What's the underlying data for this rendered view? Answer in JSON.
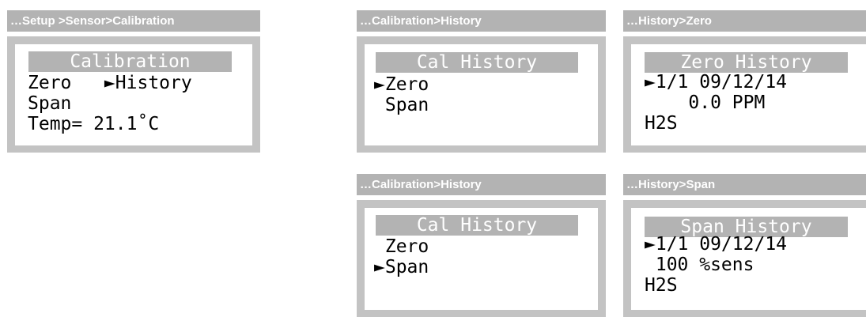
{
  "p1": {
    "header": "…Setup >Sensor>Calibration",
    "title": "Calibration",
    "line1": "Zero   ►History",
    "line2": "Span",
    "line3": "Temp= 21.1˚C"
  },
  "p2": {
    "header": "…Calibration>History",
    "title": "Cal History",
    "line1": "►Zero",
    "line2": " Span"
  },
  "p3": {
    "header": "…History>Zero",
    "title": "Zero History",
    "line1": "►1/1 09/12/14",
    "line2": "    0.0 PPM",
    "line3": "H2S"
  },
  "p4": {
    "header": "…Calibration>History",
    "title": "Cal History",
    "line1": " Zero",
    "line2": "►Span"
  },
  "p5": {
    "header": "…History>Span",
    "title": "Span History",
    "line1": "►1/1 09/12/14",
    "line2": " 100 %sens",
    "line3": "H2S"
  }
}
